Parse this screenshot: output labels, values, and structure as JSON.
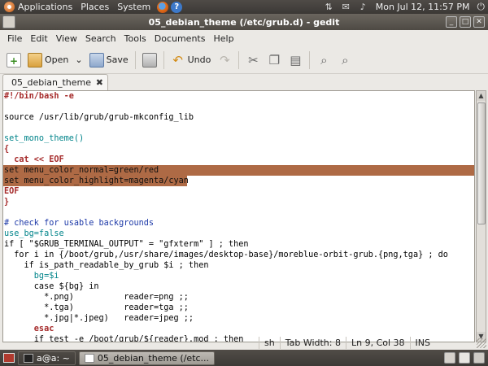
{
  "top_panel": {
    "menus": [
      "Applications",
      "Places",
      "System"
    ],
    "clock": "Mon Jul 12, 11:57 PM"
  },
  "window": {
    "title": "05_debian_theme (/etc/grub.d) - gedit"
  },
  "menubar": [
    "File",
    "Edit",
    "View",
    "Search",
    "Tools",
    "Documents",
    "Help"
  ],
  "toolbar": {
    "open_label": "Open",
    "save_label": "Save",
    "undo_label": "Undo"
  },
  "tab": {
    "label": "05_debian_theme"
  },
  "editor": {
    "lines": [
      "#!/bin/bash -e",
      "",
      "source /usr/lib/grub/grub-mkconfig_lib",
      "",
      "set_mono_theme()",
      "{",
      "  cat << EOF",
      "set menu_color_normal=green/red",
      "set menu_color_highlight=magenta/cyan",
      "EOF",
      "}",
      "",
      "# check for usable backgrounds",
      "use_bg=false",
      "if [ \"$GRUB_TERMINAL_OUTPUT\" = \"gfxterm\" ] ; then",
      "  for i in {/boot/grub,/usr/share/images/desktop-base}/moreblue-orbit-grub.{png,tga} ; do",
      "    if is_path_readable_by_grub $i ; then",
      "      bg=$i",
      "      case ${bg} in",
      "        *.png)          reader=png ;;",
      "        *.tga)          reader=tga ;;",
      "        *.jpg|*.jpeg)   reader=jpeg ;;",
      "      esac",
      "      if test -e /boot/grub/${reader}.mod ; then"
    ]
  },
  "statusbar": {
    "language": "sh",
    "tab_width": "Tab Width: 8",
    "position": "Ln 9, Col 38",
    "mode": "INS"
  },
  "bottom_panel": {
    "tasks": [
      "a@a: ~",
      "05_debian_theme (/etc..."
    ]
  }
}
